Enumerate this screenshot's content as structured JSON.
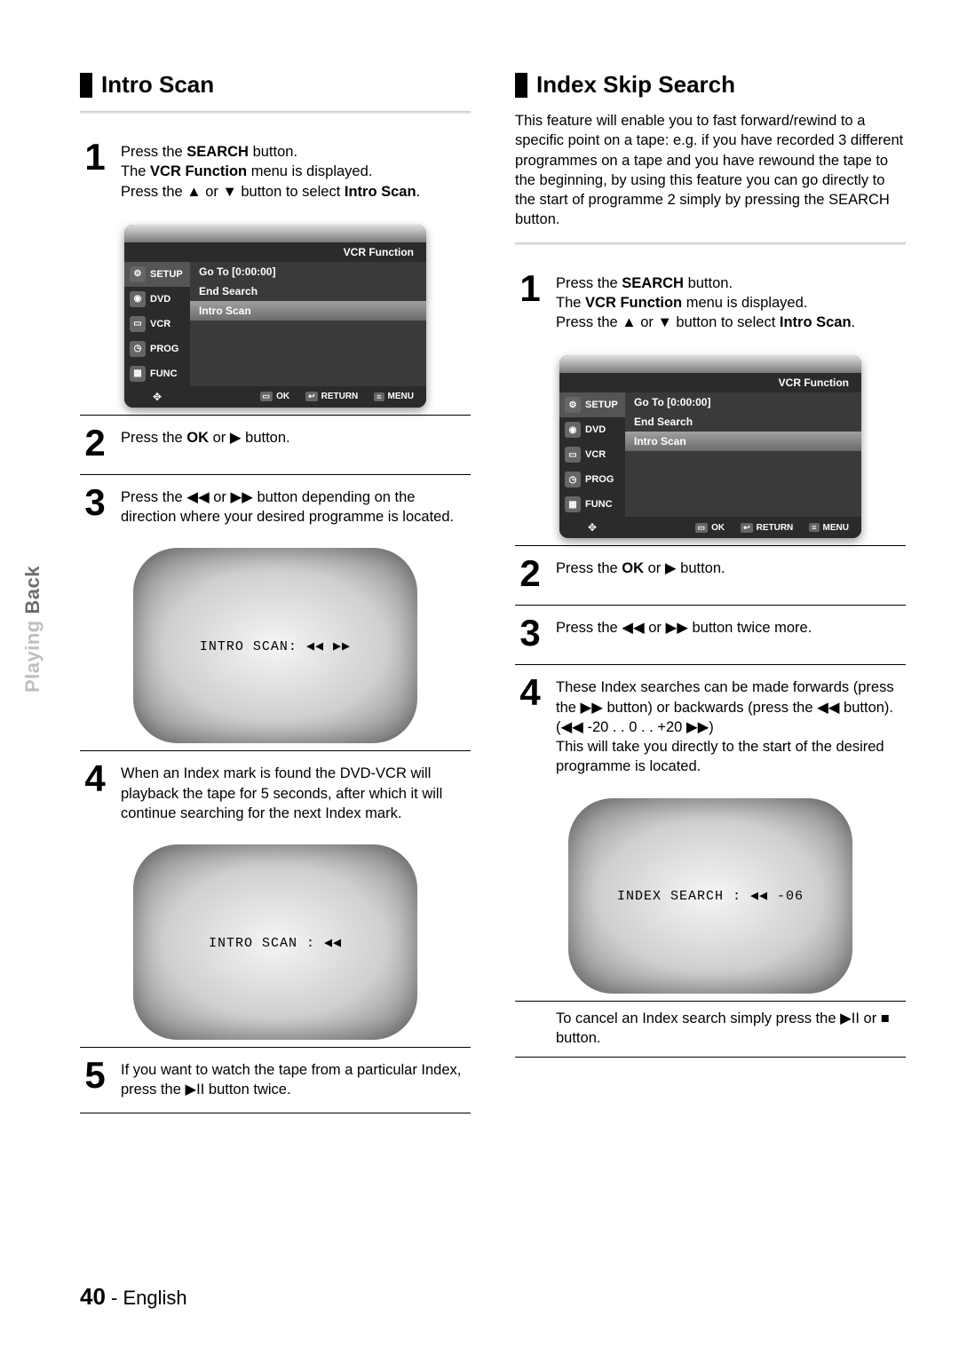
{
  "side_tab": {
    "light": "Playing ",
    "dark": "Back"
  },
  "left": {
    "title": "Intro Scan",
    "steps": {
      "s1_a": "Press the ",
      "s1_b": "SEARCH",
      "s1_c": " button.",
      "s1_d": "The ",
      "s1_e": "VCR Function",
      "s1_f": " menu is displayed.",
      "s1_g": "Press the ▲ or ▼ button to select ",
      "s1_h": "Intro Scan",
      "s1_i": ".",
      "s2_a": "Press the ",
      "s2_b": "OK",
      "s2_c": " or ▶ button.",
      "s3": "Press the ◀◀ or ▶▶ button depending on the direction where your desired programme is located.",
      "s4": "When an Index mark is found the DVD-VCR will playback the tape for 5 seconds, after which it will continue searching for the next Index mark.",
      "s5": "If you want to watch the tape from a particular Index, press the ▶II button twice."
    },
    "tv1": "INTRO SCAN: ◀◀  ▶▶",
    "tv2": "INTRO SCAN : ◀◀"
  },
  "right": {
    "title": "Index Skip Search",
    "intro_a": "This feature will enable you to fast forward/rewind to a specific point on a tape: e.g. if you have recorded 3 different programmes on a tape and you have rewound the tape to the beginning, by using this feature you can go directly to the start of programme 2 simply by pressing the ",
    "intro_b": "SEARCH",
    "intro_c": " button.",
    "steps": {
      "s1_a": "Press the ",
      "s1_b": "SEARCH",
      "s1_c": " button.",
      "s1_d": "The ",
      "s1_e": "VCR Function",
      "s1_f": " menu is displayed.",
      "s1_g": "Press the ▲ or ▼ button to select ",
      "s1_h": "Intro Scan",
      "s1_i": ".",
      "s2_a": "Press the ",
      "s2_b": "OK",
      "s2_c": " or ▶ button.",
      "s3": "Press the ◀◀ or ▶▶ button twice more.",
      "s4_a": "These Index searches can be made forwards (press the ▶▶ button) or backwards (press the ◀◀ button).",
      "s4_b": "(◀◀ -20 . . 0 . . +20 ▶▶)",
      "s4_c": "This will take you directly to the start of the desired programme is located."
    },
    "tv": "INDEX SEARCH : ◀◀ -06",
    "cancel": "To cancel an Index search simply press the ▶II or ■ button."
  },
  "osd": {
    "header": "VCR Function",
    "side": [
      "SETUP",
      "DVD",
      "VCR",
      "PROG",
      "FUNC"
    ],
    "rows": [
      "Go To [0:00:00]",
      "End Search",
      "Intro Scan"
    ],
    "foot": {
      "ok": "OK",
      "return": "RETURN",
      "menu": "MENU"
    }
  },
  "footer": {
    "page": "40",
    "sep": " - ",
    "lang": "English"
  }
}
